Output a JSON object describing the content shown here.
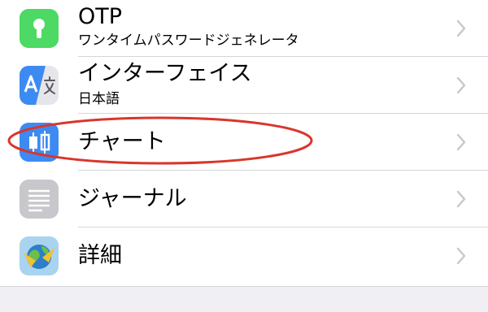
{
  "settings_list": {
    "items": [
      {
        "key": "otp",
        "title": "OTP",
        "subtitle": "ワンタイムパスワードジェネレータ",
        "icon": "key-icon",
        "icon_color": "#4cd964"
      },
      {
        "key": "interface",
        "title": "インターフェイス",
        "subtitle": "日本語",
        "icon": "translate-icon",
        "icon_color": "#3d8bf2"
      },
      {
        "key": "chart",
        "title": "チャート",
        "subtitle": "",
        "icon": "candlestick-chart-icon",
        "icon_color": "#3d8bf2"
      },
      {
        "key": "journal",
        "title": "ジャーナル",
        "subtitle": "",
        "icon": "document-lines-icon",
        "icon_color": "#c7c7cc"
      },
      {
        "key": "about",
        "title": "詳細",
        "subtitle": "",
        "icon": "metatrader-globe-icon",
        "icon_color": "#a9d3ef"
      }
    ]
  },
  "highlight": {
    "target": "chart",
    "color": "#d9362b"
  }
}
